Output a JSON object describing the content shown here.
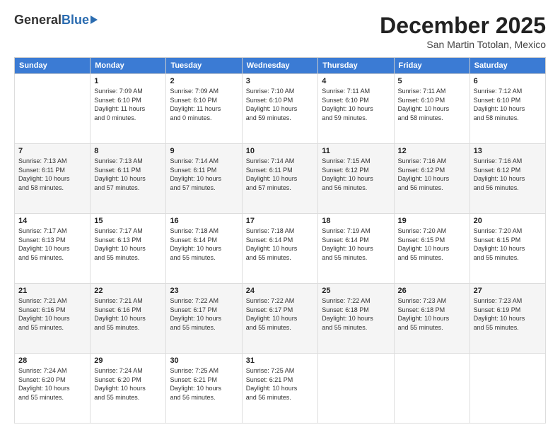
{
  "logo": {
    "general": "General",
    "blue": "Blue"
  },
  "header": {
    "month": "December 2025",
    "location": "San Martin Totolan, Mexico"
  },
  "weekdays": [
    "Sunday",
    "Monday",
    "Tuesday",
    "Wednesday",
    "Thursday",
    "Friday",
    "Saturday"
  ],
  "weeks": [
    [
      {
        "day": "",
        "info": ""
      },
      {
        "day": "1",
        "info": "Sunrise: 7:09 AM\nSunset: 6:10 PM\nDaylight: 11 hours\nand 0 minutes."
      },
      {
        "day": "2",
        "info": "Sunrise: 7:09 AM\nSunset: 6:10 PM\nDaylight: 11 hours\nand 0 minutes."
      },
      {
        "day": "3",
        "info": "Sunrise: 7:10 AM\nSunset: 6:10 PM\nDaylight: 10 hours\nand 59 minutes."
      },
      {
        "day": "4",
        "info": "Sunrise: 7:11 AM\nSunset: 6:10 PM\nDaylight: 10 hours\nand 59 minutes."
      },
      {
        "day": "5",
        "info": "Sunrise: 7:11 AM\nSunset: 6:10 PM\nDaylight: 10 hours\nand 58 minutes."
      },
      {
        "day": "6",
        "info": "Sunrise: 7:12 AM\nSunset: 6:10 PM\nDaylight: 10 hours\nand 58 minutes."
      }
    ],
    [
      {
        "day": "7",
        "info": "Sunrise: 7:13 AM\nSunset: 6:11 PM\nDaylight: 10 hours\nand 58 minutes."
      },
      {
        "day": "8",
        "info": "Sunrise: 7:13 AM\nSunset: 6:11 PM\nDaylight: 10 hours\nand 57 minutes."
      },
      {
        "day": "9",
        "info": "Sunrise: 7:14 AM\nSunset: 6:11 PM\nDaylight: 10 hours\nand 57 minutes."
      },
      {
        "day": "10",
        "info": "Sunrise: 7:14 AM\nSunset: 6:11 PM\nDaylight: 10 hours\nand 57 minutes."
      },
      {
        "day": "11",
        "info": "Sunrise: 7:15 AM\nSunset: 6:12 PM\nDaylight: 10 hours\nand 56 minutes."
      },
      {
        "day": "12",
        "info": "Sunrise: 7:16 AM\nSunset: 6:12 PM\nDaylight: 10 hours\nand 56 minutes."
      },
      {
        "day": "13",
        "info": "Sunrise: 7:16 AM\nSunset: 6:12 PM\nDaylight: 10 hours\nand 56 minutes."
      }
    ],
    [
      {
        "day": "14",
        "info": "Sunrise: 7:17 AM\nSunset: 6:13 PM\nDaylight: 10 hours\nand 56 minutes."
      },
      {
        "day": "15",
        "info": "Sunrise: 7:17 AM\nSunset: 6:13 PM\nDaylight: 10 hours\nand 55 minutes."
      },
      {
        "day": "16",
        "info": "Sunrise: 7:18 AM\nSunset: 6:14 PM\nDaylight: 10 hours\nand 55 minutes."
      },
      {
        "day": "17",
        "info": "Sunrise: 7:18 AM\nSunset: 6:14 PM\nDaylight: 10 hours\nand 55 minutes."
      },
      {
        "day": "18",
        "info": "Sunrise: 7:19 AM\nSunset: 6:14 PM\nDaylight: 10 hours\nand 55 minutes."
      },
      {
        "day": "19",
        "info": "Sunrise: 7:20 AM\nSunset: 6:15 PM\nDaylight: 10 hours\nand 55 minutes."
      },
      {
        "day": "20",
        "info": "Sunrise: 7:20 AM\nSunset: 6:15 PM\nDaylight: 10 hours\nand 55 minutes."
      }
    ],
    [
      {
        "day": "21",
        "info": "Sunrise: 7:21 AM\nSunset: 6:16 PM\nDaylight: 10 hours\nand 55 minutes."
      },
      {
        "day": "22",
        "info": "Sunrise: 7:21 AM\nSunset: 6:16 PM\nDaylight: 10 hours\nand 55 minutes."
      },
      {
        "day": "23",
        "info": "Sunrise: 7:22 AM\nSunset: 6:17 PM\nDaylight: 10 hours\nand 55 minutes."
      },
      {
        "day": "24",
        "info": "Sunrise: 7:22 AM\nSunset: 6:17 PM\nDaylight: 10 hours\nand 55 minutes."
      },
      {
        "day": "25",
        "info": "Sunrise: 7:22 AM\nSunset: 6:18 PM\nDaylight: 10 hours\nand 55 minutes."
      },
      {
        "day": "26",
        "info": "Sunrise: 7:23 AM\nSunset: 6:18 PM\nDaylight: 10 hours\nand 55 minutes."
      },
      {
        "day": "27",
        "info": "Sunrise: 7:23 AM\nSunset: 6:19 PM\nDaylight: 10 hours\nand 55 minutes."
      }
    ],
    [
      {
        "day": "28",
        "info": "Sunrise: 7:24 AM\nSunset: 6:20 PM\nDaylight: 10 hours\nand 55 minutes."
      },
      {
        "day": "29",
        "info": "Sunrise: 7:24 AM\nSunset: 6:20 PM\nDaylight: 10 hours\nand 55 minutes."
      },
      {
        "day": "30",
        "info": "Sunrise: 7:25 AM\nSunset: 6:21 PM\nDaylight: 10 hours\nand 56 minutes."
      },
      {
        "day": "31",
        "info": "Sunrise: 7:25 AM\nSunset: 6:21 PM\nDaylight: 10 hours\nand 56 minutes."
      },
      {
        "day": "",
        "info": ""
      },
      {
        "day": "",
        "info": ""
      },
      {
        "day": "",
        "info": ""
      }
    ]
  ]
}
